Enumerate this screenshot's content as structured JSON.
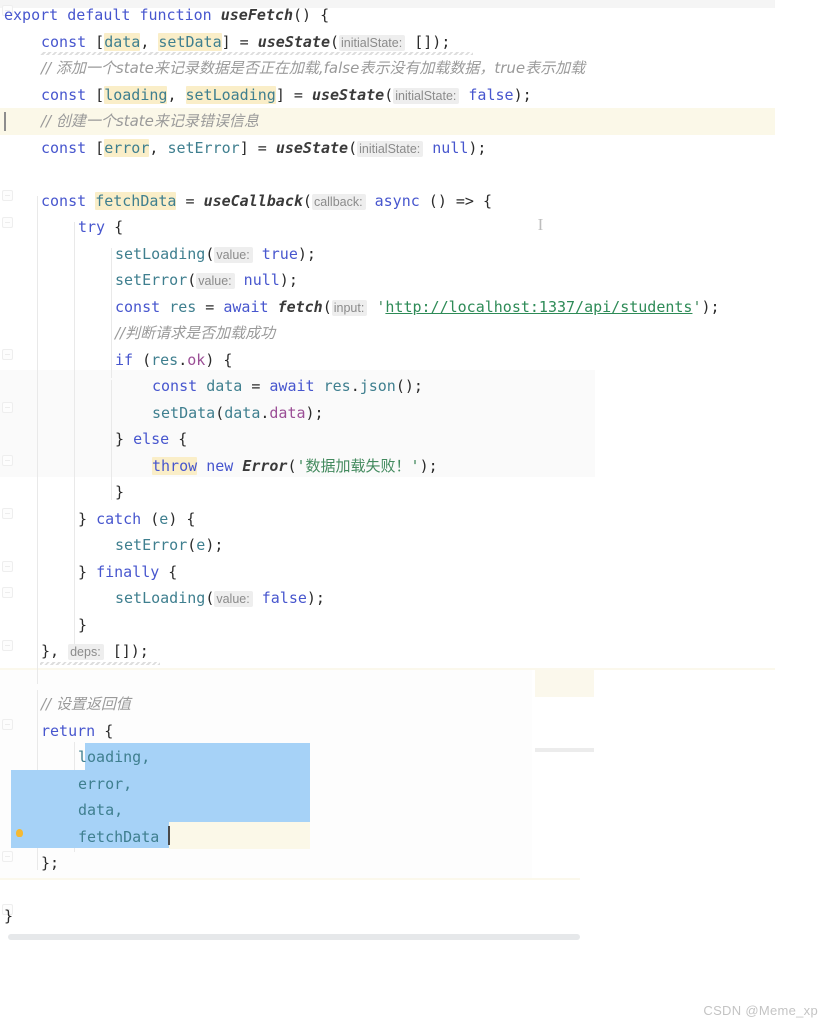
{
  "editor": {
    "language": "javascript",
    "file_kind": "react-hook",
    "colors": {
      "background": "#ffffff",
      "keyword": "#4756ce",
      "identifier": "#3f7f8f",
      "string": "#438a5e",
      "url_string": "#2e8b57",
      "comment": "#9a9a9a",
      "property": "#9b4f96",
      "occurrence_highlight": "#faeec8",
      "caret_line": "#fbf8e8",
      "selection": "#a6d2f7",
      "inlay_hint_bg": "#eeeeee",
      "inlay_hint_fg": "#8b8b8b",
      "scrollbar_thumb": "#e6e8ea",
      "bulb": "#f5b932"
    },
    "mouse_cursor": "text-ibeam-cursor"
  },
  "code_lines": [
    {
      "n": 1,
      "indent": 0,
      "tokens": [
        {
          "t": "export",
          "c": "kw"
        },
        {
          "t": " ",
          "c": "plain"
        },
        {
          "t": "default",
          "c": "kw"
        },
        {
          "t": " ",
          "c": "plain"
        },
        {
          "t": "function",
          "c": "kw"
        },
        {
          "t": " ",
          "c": "plain"
        },
        {
          "t": "useFetch",
          "c": "fn"
        },
        {
          "t": "() {",
          "c": "punct"
        }
      ]
    },
    {
      "n": 2,
      "indent": 1,
      "tokens": [
        {
          "t": "const",
          "c": "kw"
        },
        {
          "t": " [",
          "c": "punct"
        },
        {
          "t": "data",
          "c": "occ-ident"
        },
        {
          "t": ", ",
          "c": "punct"
        },
        {
          "t": "setData",
          "c": "occ-ident"
        },
        {
          "t": "] = ",
          "c": "punct"
        },
        {
          "t": "useState",
          "c": "fn"
        },
        {
          "t": "(",
          "c": "punct"
        },
        {
          "t": "initialState:",
          "c": "hint"
        },
        {
          "t": " [])",
          "c": "punct"
        },
        {
          "t": ";",
          "c": "punct"
        }
      ]
    },
    {
      "n": 3,
      "indent": 1,
      "tokens": [
        {
          "t": "// 添加一个state来记录数据是否正在加载,false表示没有加载数据，true表示加载",
          "c": "cmt"
        }
      ]
    },
    {
      "n": 4,
      "indent": 1,
      "tokens": [
        {
          "t": "const",
          "c": "kw"
        },
        {
          "t": " [",
          "c": "punct"
        },
        {
          "t": "loading",
          "c": "occ-ident"
        },
        {
          "t": ", ",
          "c": "punct"
        },
        {
          "t": "setLoading",
          "c": "occ-ident"
        },
        {
          "t": "] = ",
          "c": "punct"
        },
        {
          "t": "useState",
          "c": "fn"
        },
        {
          "t": "(",
          "c": "punct"
        },
        {
          "t": "initialState:",
          "c": "hint"
        },
        {
          "t": " ",
          "c": "plain"
        },
        {
          "t": "false",
          "c": "kw"
        },
        {
          "t": ");",
          "c": "punct"
        }
      ]
    },
    {
      "n": 5,
      "indent": 1,
      "caret_line": true,
      "tokens": [
        {
          "t": "// 创建一个state来记录错误信息",
          "c": "cmt"
        }
      ]
    },
    {
      "n": 6,
      "indent": 1,
      "tokens": [
        {
          "t": "const",
          "c": "kw"
        },
        {
          "t": " [",
          "c": "punct"
        },
        {
          "t": "error",
          "c": "occ-ident"
        },
        {
          "t": ", ",
          "c": "punct"
        },
        {
          "t": "setError",
          "c": "ident"
        },
        {
          "t": "] = ",
          "c": "punct"
        },
        {
          "t": "useState",
          "c": "fn"
        },
        {
          "t": "(",
          "c": "punct"
        },
        {
          "t": "initialState:",
          "c": "hint"
        },
        {
          "t": " ",
          "c": "plain"
        },
        {
          "t": "null",
          "c": "kw"
        },
        {
          "t": ");",
          "c": "punct"
        }
      ]
    },
    {
      "n": 7,
      "indent": 0,
      "tokens": []
    },
    {
      "n": 8,
      "indent": 1,
      "tokens": [
        {
          "t": "const",
          "c": "kw"
        },
        {
          "t": " ",
          "c": "plain"
        },
        {
          "t": "fetchData",
          "c": "occ-ident"
        },
        {
          "t": " = ",
          "c": "punct"
        },
        {
          "t": "useCallback",
          "c": "fn"
        },
        {
          "t": "(",
          "c": "punct"
        },
        {
          "t": "callback:",
          "c": "hint"
        },
        {
          "t": " ",
          "c": "plain"
        },
        {
          "t": "async",
          "c": "kw"
        },
        {
          "t": " () => {",
          "c": "punct"
        }
      ]
    },
    {
      "n": 9,
      "indent": 2,
      "tokens": [
        {
          "t": "try",
          "c": "kw"
        },
        {
          "t": " {",
          "c": "punct"
        }
      ]
    },
    {
      "n": 10,
      "indent": 3,
      "tokens": [
        {
          "t": "setLoading",
          "c": "ident"
        },
        {
          "t": "(",
          "c": "punct"
        },
        {
          "t": "value:",
          "c": "hint"
        },
        {
          "t": " ",
          "c": "plain"
        },
        {
          "t": "true",
          "c": "kw"
        },
        {
          "t": ");",
          "c": "punct"
        }
      ]
    },
    {
      "n": 11,
      "indent": 3,
      "tokens": [
        {
          "t": "setError",
          "c": "ident"
        },
        {
          "t": "(",
          "c": "punct"
        },
        {
          "t": "value:",
          "c": "hint"
        },
        {
          "t": " ",
          "c": "plain"
        },
        {
          "t": "null",
          "c": "kw"
        },
        {
          "t": ");",
          "c": "punct"
        }
      ]
    },
    {
      "n": 12,
      "indent": 3,
      "tokens": [
        {
          "t": "const",
          "c": "kw"
        },
        {
          "t": " ",
          "c": "plain"
        },
        {
          "t": "res",
          "c": "var"
        },
        {
          "t": " = ",
          "c": "punct"
        },
        {
          "t": "await",
          "c": "kw"
        },
        {
          "t": " ",
          "c": "plain"
        },
        {
          "t": "fetch",
          "c": "fn"
        },
        {
          "t": "(",
          "c": "punct"
        },
        {
          "t": "input:",
          "c": "hint"
        },
        {
          "t": " ",
          "c": "plain"
        },
        {
          "t": "'",
          "c": "str"
        },
        {
          "t": "http://localhost:1337/api/students",
          "c": "url"
        },
        {
          "t": "'",
          "c": "str"
        },
        {
          "t": ");",
          "c": "punct"
        }
      ]
    },
    {
      "n": 13,
      "indent": 3,
      "tokens": [
        {
          "t": "//判断请求是否加载成功",
          "c": "cmt"
        }
      ]
    },
    {
      "n": 14,
      "indent": 3,
      "tokens": [
        {
          "t": "if",
          "c": "kw"
        },
        {
          "t": " (",
          "c": "punct"
        },
        {
          "t": "res",
          "c": "var"
        },
        {
          "t": ".",
          "c": "punct"
        },
        {
          "t": "ok",
          "c": "prop"
        },
        {
          "t": ") {",
          "c": "punct"
        }
      ]
    },
    {
      "n": 15,
      "indent": 4,
      "tokens": [
        {
          "t": "const",
          "c": "kw"
        },
        {
          "t": " ",
          "c": "plain"
        },
        {
          "t": "data",
          "c": "var"
        },
        {
          "t": " = ",
          "c": "punct"
        },
        {
          "t": "await",
          "c": "kw"
        },
        {
          "t": " ",
          "c": "plain"
        },
        {
          "t": "res",
          "c": "var"
        },
        {
          "t": ".",
          "c": "punct"
        },
        {
          "t": "json",
          "c": "ident"
        },
        {
          "t": "();",
          "c": "punct"
        }
      ]
    },
    {
      "n": 16,
      "indent": 4,
      "tokens": [
        {
          "t": "setData",
          "c": "ident"
        },
        {
          "t": "(",
          "c": "punct"
        },
        {
          "t": "data",
          "c": "var"
        },
        {
          "t": ".",
          "c": "punct"
        },
        {
          "t": "data",
          "c": "prop"
        },
        {
          "t": ");",
          "c": "punct"
        }
      ]
    },
    {
      "n": 17,
      "indent": 3,
      "tokens": [
        {
          "t": "} ",
          "c": "punct"
        },
        {
          "t": "else",
          "c": "kw"
        },
        {
          "t": " {",
          "c": "punct"
        }
      ]
    },
    {
      "n": 18,
      "indent": 4,
      "tokens": [
        {
          "t": "throw",
          "c": "occ-kw"
        },
        {
          "t": " ",
          "c": "plain"
        },
        {
          "t": "new",
          "c": "kw"
        },
        {
          "t": " ",
          "c": "plain"
        },
        {
          "t": "Error",
          "c": "fn"
        },
        {
          "t": "(",
          "c": "punct"
        },
        {
          "t": "'数据加载失败！'",
          "c": "str"
        },
        {
          "t": ");",
          "c": "punct"
        }
      ]
    },
    {
      "n": 19,
      "indent": 3,
      "tokens": [
        {
          "t": "}",
          "c": "punct"
        }
      ]
    },
    {
      "n": 20,
      "indent": 2,
      "tokens": [
        {
          "t": "} ",
          "c": "punct"
        },
        {
          "t": "catch",
          "c": "kw"
        },
        {
          "t": " (",
          "c": "punct"
        },
        {
          "t": "e",
          "c": "var"
        },
        {
          "t": ") {",
          "c": "punct"
        }
      ]
    },
    {
      "n": 21,
      "indent": 3,
      "tokens": [
        {
          "t": "setError",
          "c": "ident"
        },
        {
          "t": "(",
          "c": "punct"
        },
        {
          "t": "e",
          "c": "var"
        },
        {
          "t": ");",
          "c": "punct"
        }
      ]
    },
    {
      "n": 22,
      "indent": 2,
      "tokens": [
        {
          "t": "} ",
          "c": "punct"
        },
        {
          "t": "finally",
          "c": "kw"
        },
        {
          "t": " {",
          "c": "punct"
        }
      ]
    },
    {
      "n": 23,
      "indent": 3,
      "tokens": [
        {
          "t": "setLoading",
          "c": "ident"
        },
        {
          "t": "(",
          "c": "punct"
        },
        {
          "t": "value:",
          "c": "hint"
        },
        {
          "t": " ",
          "c": "plain"
        },
        {
          "t": "false",
          "c": "kw"
        },
        {
          "t": ");",
          "c": "punct"
        }
      ]
    },
    {
      "n": 24,
      "indent": 2,
      "tokens": [
        {
          "t": "}",
          "c": "punct"
        }
      ]
    },
    {
      "n": 25,
      "indent": 1,
      "tokens": [
        {
          "t": "}, ",
          "c": "punct"
        },
        {
          "t": "deps:",
          "c": "hint"
        },
        {
          "t": " []);",
          "c": "punct"
        }
      ]
    },
    {
      "n": 26,
      "indent": 0,
      "tokens": []
    },
    {
      "n": 27,
      "indent": 1,
      "tokens": [
        {
          "t": "// 设置返回值",
          "c": "cmt"
        }
      ]
    },
    {
      "n": 28,
      "indent": 1,
      "tokens": [
        {
          "t": "return",
          "c": "kw"
        },
        {
          "t": " {",
          "c": "punct"
        }
      ]
    },
    {
      "n": 29,
      "indent": 2,
      "selected": true,
      "tokens": [
        {
          "t": "loading,",
          "c": "ident"
        }
      ]
    },
    {
      "n": 30,
      "indent": 2,
      "selected": true,
      "tokens": [
        {
          "t": "error,",
          "c": "ident"
        }
      ]
    },
    {
      "n": 31,
      "indent": 2,
      "selected": true,
      "tokens": [
        {
          "t": "data,",
          "c": "ident"
        }
      ]
    },
    {
      "n": 32,
      "indent": 2,
      "selected": true,
      "caret_line": true,
      "tokens": [
        {
          "t": "fetchData",
          "c": "ident"
        }
      ]
    },
    {
      "n": 33,
      "indent": 1,
      "tokens": [
        {
          "t": "};",
          "c": "punct"
        }
      ]
    },
    {
      "n": 34,
      "indent": 0,
      "tokens": []
    },
    {
      "n": 35,
      "indent": 0,
      "tokens": [
        {
          "t": "}",
          "c": "punct"
        }
      ]
    }
  ],
  "watermark": {
    "text": "CSDN @Meme_xp"
  },
  "scrollbar": {
    "orientation": "horizontal",
    "position": "bottom"
  }
}
